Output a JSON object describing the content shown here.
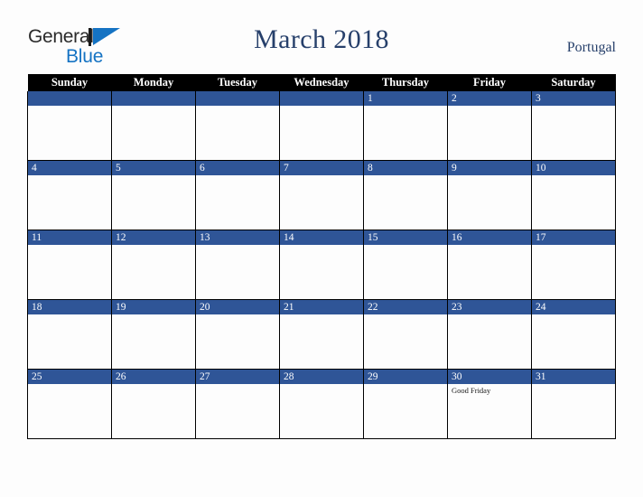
{
  "brand": {
    "name_part1": "General",
    "name_part2": "Blue",
    "mark_icon": "triangle-logo-icon"
  },
  "header": {
    "title": "March 2018",
    "locale": "Portugal"
  },
  "colors": {
    "header_row_bg": "#000000",
    "date_bar_bg": "#2f5597",
    "title_text": "#27406b",
    "brand_blue": "#1573c3",
    "page_bg": "#fdfdfd",
    "grid_line": "#000000"
  },
  "calendar": {
    "weekday_headers": [
      "Sunday",
      "Monday",
      "Tuesday",
      "Wednesday",
      "Thursday",
      "Friday",
      "Saturday"
    ],
    "weeks": [
      [
        {
          "day": "",
          "events": []
        },
        {
          "day": "",
          "events": []
        },
        {
          "day": "",
          "events": []
        },
        {
          "day": "",
          "events": []
        },
        {
          "day": "1",
          "events": []
        },
        {
          "day": "2",
          "events": []
        },
        {
          "day": "3",
          "events": []
        }
      ],
      [
        {
          "day": "4",
          "events": []
        },
        {
          "day": "5",
          "events": []
        },
        {
          "day": "6",
          "events": []
        },
        {
          "day": "7",
          "events": []
        },
        {
          "day": "8",
          "events": []
        },
        {
          "day": "9",
          "events": []
        },
        {
          "day": "10",
          "events": []
        }
      ],
      [
        {
          "day": "11",
          "events": []
        },
        {
          "day": "12",
          "events": []
        },
        {
          "day": "13",
          "events": []
        },
        {
          "day": "14",
          "events": []
        },
        {
          "day": "15",
          "events": []
        },
        {
          "day": "16",
          "events": []
        },
        {
          "day": "17",
          "events": []
        }
      ],
      [
        {
          "day": "18",
          "events": []
        },
        {
          "day": "19",
          "events": []
        },
        {
          "day": "20",
          "events": []
        },
        {
          "day": "21",
          "events": []
        },
        {
          "day": "22",
          "events": []
        },
        {
          "day": "23",
          "events": []
        },
        {
          "day": "24",
          "events": []
        }
      ],
      [
        {
          "day": "25",
          "events": []
        },
        {
          "day": "26",
          "events": []
        },
        {
          "day": "27",
          "events": []
        },
        {
          "day": "28",
          "events": []
        },
        {
          "day": "29",
          "events": []
        },
        {
          "day": "30",
          "events": [
            "Good Friday"
          ]
        },
        {
          "day": "31",
          "events": []
        }
      ]
    ]
  }
}
